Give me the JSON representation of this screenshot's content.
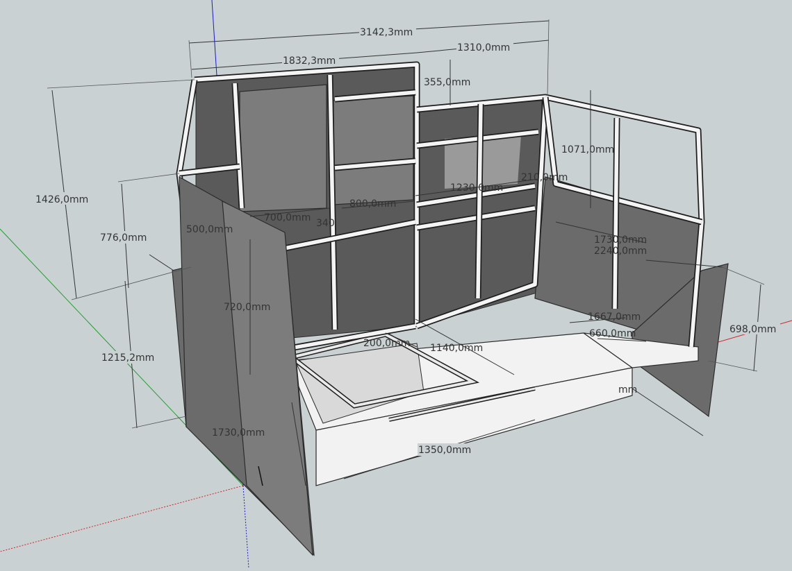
{
  "axes": {
    "red": "#d0242a",
    "green": "#1f9e2c",
    "blue": "#1a1ad1"
  },
  "dimensions": {
    "d3142": "3142,3mm",
    "d1832": "1832,3mm",
    "d1310": "1310,0mm",
    "d355": "355,0mm",
    "d1426": "1426,0mm",
    "d776": "776,0mm",
    "d1215": "1215,2mm",
    "d1071": "1071,0mm",
    "d1230": "1230,0mm",
    "d800": "800,0mm",
    "d700": "700,0mm",
    "d500": "500,0mm",
    "d340": "340",
    "d720": "720,0mm",
    "d1730a": "1730,0mm",
    "d1730b": "1730,0mm",
    "d2240": "2240,0mm",
    "d1667": "1667,0mm",
    "d660": "660,0mm",
    "d698": "698,0mm",
    "d200": "200,0mm",
    "d1140": "1140,0mm",
    "d1350": "1350,0mm",
    "d210": "210,0mm",
    "dmm": "mm"
  }
}
